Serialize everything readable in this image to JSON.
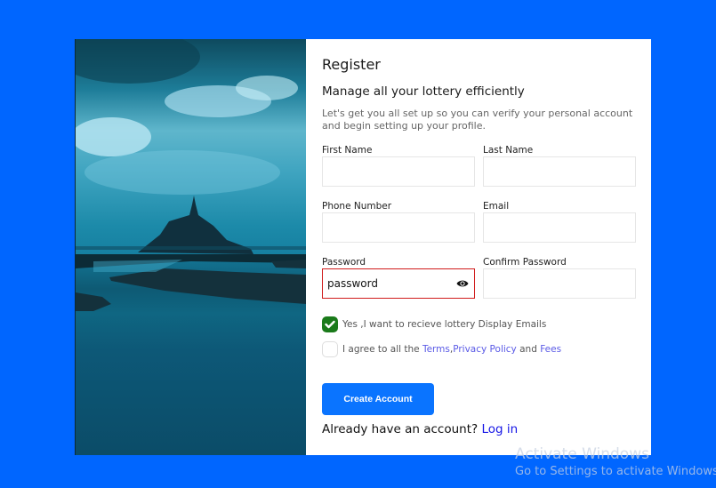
{
  "header": {
    "title": "Register",
    "subtitle": "Manage all your lottery efficiently",
    "description": "Let's get you all set up so you can verify your personal account and begin setting up your profile."
  },
  "fields": {
    "first_name": {
      "label": "First Name",
      "value": ""
    },
    "last_name": {
      "label": "Last Name",
      "value": ""
    },
    "phone": {
      "label": "Phone Number",
      "value": ""
    },
    "email": {
      "label": "Email",
      "value": ""
    },
    "password": {
      "label": "Password",
      "value": "password",
      "state": "error"
    },
    "confirm_password": {
      "label": "Confirm Password",
      "value": ""
    }
  },
  "checkboxes": {
    "emails": {
      "label": "Yes ,I want to recieve lottery Display Emails",
      "checked": true
    },
    "terms": {
      "prefix": "I agree to all the ",
      "terms_link": "Terms",
      "sep": ",",
      "privacy_link": "Privacy Policy",
      "and": " and ",
      "fees_link": "Fees",
      "checked": false
    }
  },
  "actions": {
    "create_account": "Create Account",
    "already_text": "Already have an account? ",
    "login_link": "Log in"
  },
  "watermark": {
    "line1": "Activate Windows",
    "line2": "Go to Settings to activate Windows."
  },
  "colors": {
    "background": "#0066ff",
    "primary_button": "#0a74ff",
    "error_border": "#d01c1c",
    "checkbox_checked": "#1a7a1a",
    "link": "#5a5ae6"
  }
}
